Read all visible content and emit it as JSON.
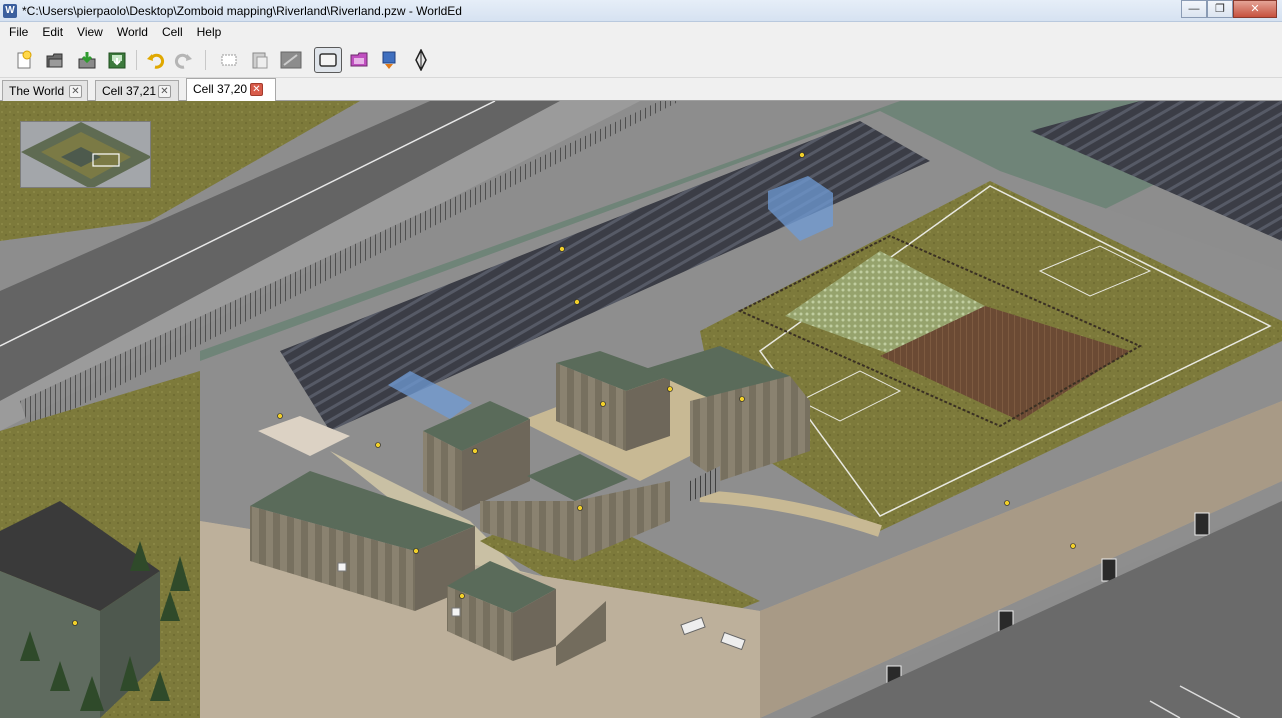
{
  "window": {
    "title": "*C:\\Users\\pierpaolo\\Desktop\\Zomboid mapping\\Riverland\\Riverland.pzw - WorldEd",
    "app_icon": "W",
    "minimize": "—",
    "maximize": "❐",
    "close": "✕"
  },
  "menu": {
    "items": [
      "File",
      "Edit",
      "View",
      "World",
      "Cell",
      "Help"
    ]
  },
  "toolbar": {
    "buttons": [
      {
        "icon": "new-world-icon"
      },
      {
        "icon": "open-icon"
      },
      {
        "icon": "save-icon"
      },
      {
        "icon": "save-as-icon"
      },
      {
        "icon": "undo-icon"
      },
      {
        "icon": "redo-icon"
      },
      {
        "icon": "select-icon"
      },
      {
        "icon": "paste-icon"
      },
      {
        "icon": "move-icon"
      },
      {
        "icon": "rectangle-select-icon",
        "pressed": true
      },
      {
        "icon": "lot-icon"
      },
      {
        "icon": "object-icon"
      },
      {
        "icon": "level-icon"
      }
    ]
  },
  "tabs": [
    {
      "label": "The World",
      "close": "✕",
      "active": false
    },
    {
      "label": "Cell 37,21",
      "close": "✕",
      "active": false
    },
    {
      "label": "Cell 37,20",
      "close": "✕",
      "active": true
    }
  ],
  "colors": {
    "grass": "#7e7a3a",
    "asphalt": "#5d5d5d",
    "wall": "#b7a894",
    "roof": "#5a6b5a",
    "selection": "#6f9bd6"
  }
}
